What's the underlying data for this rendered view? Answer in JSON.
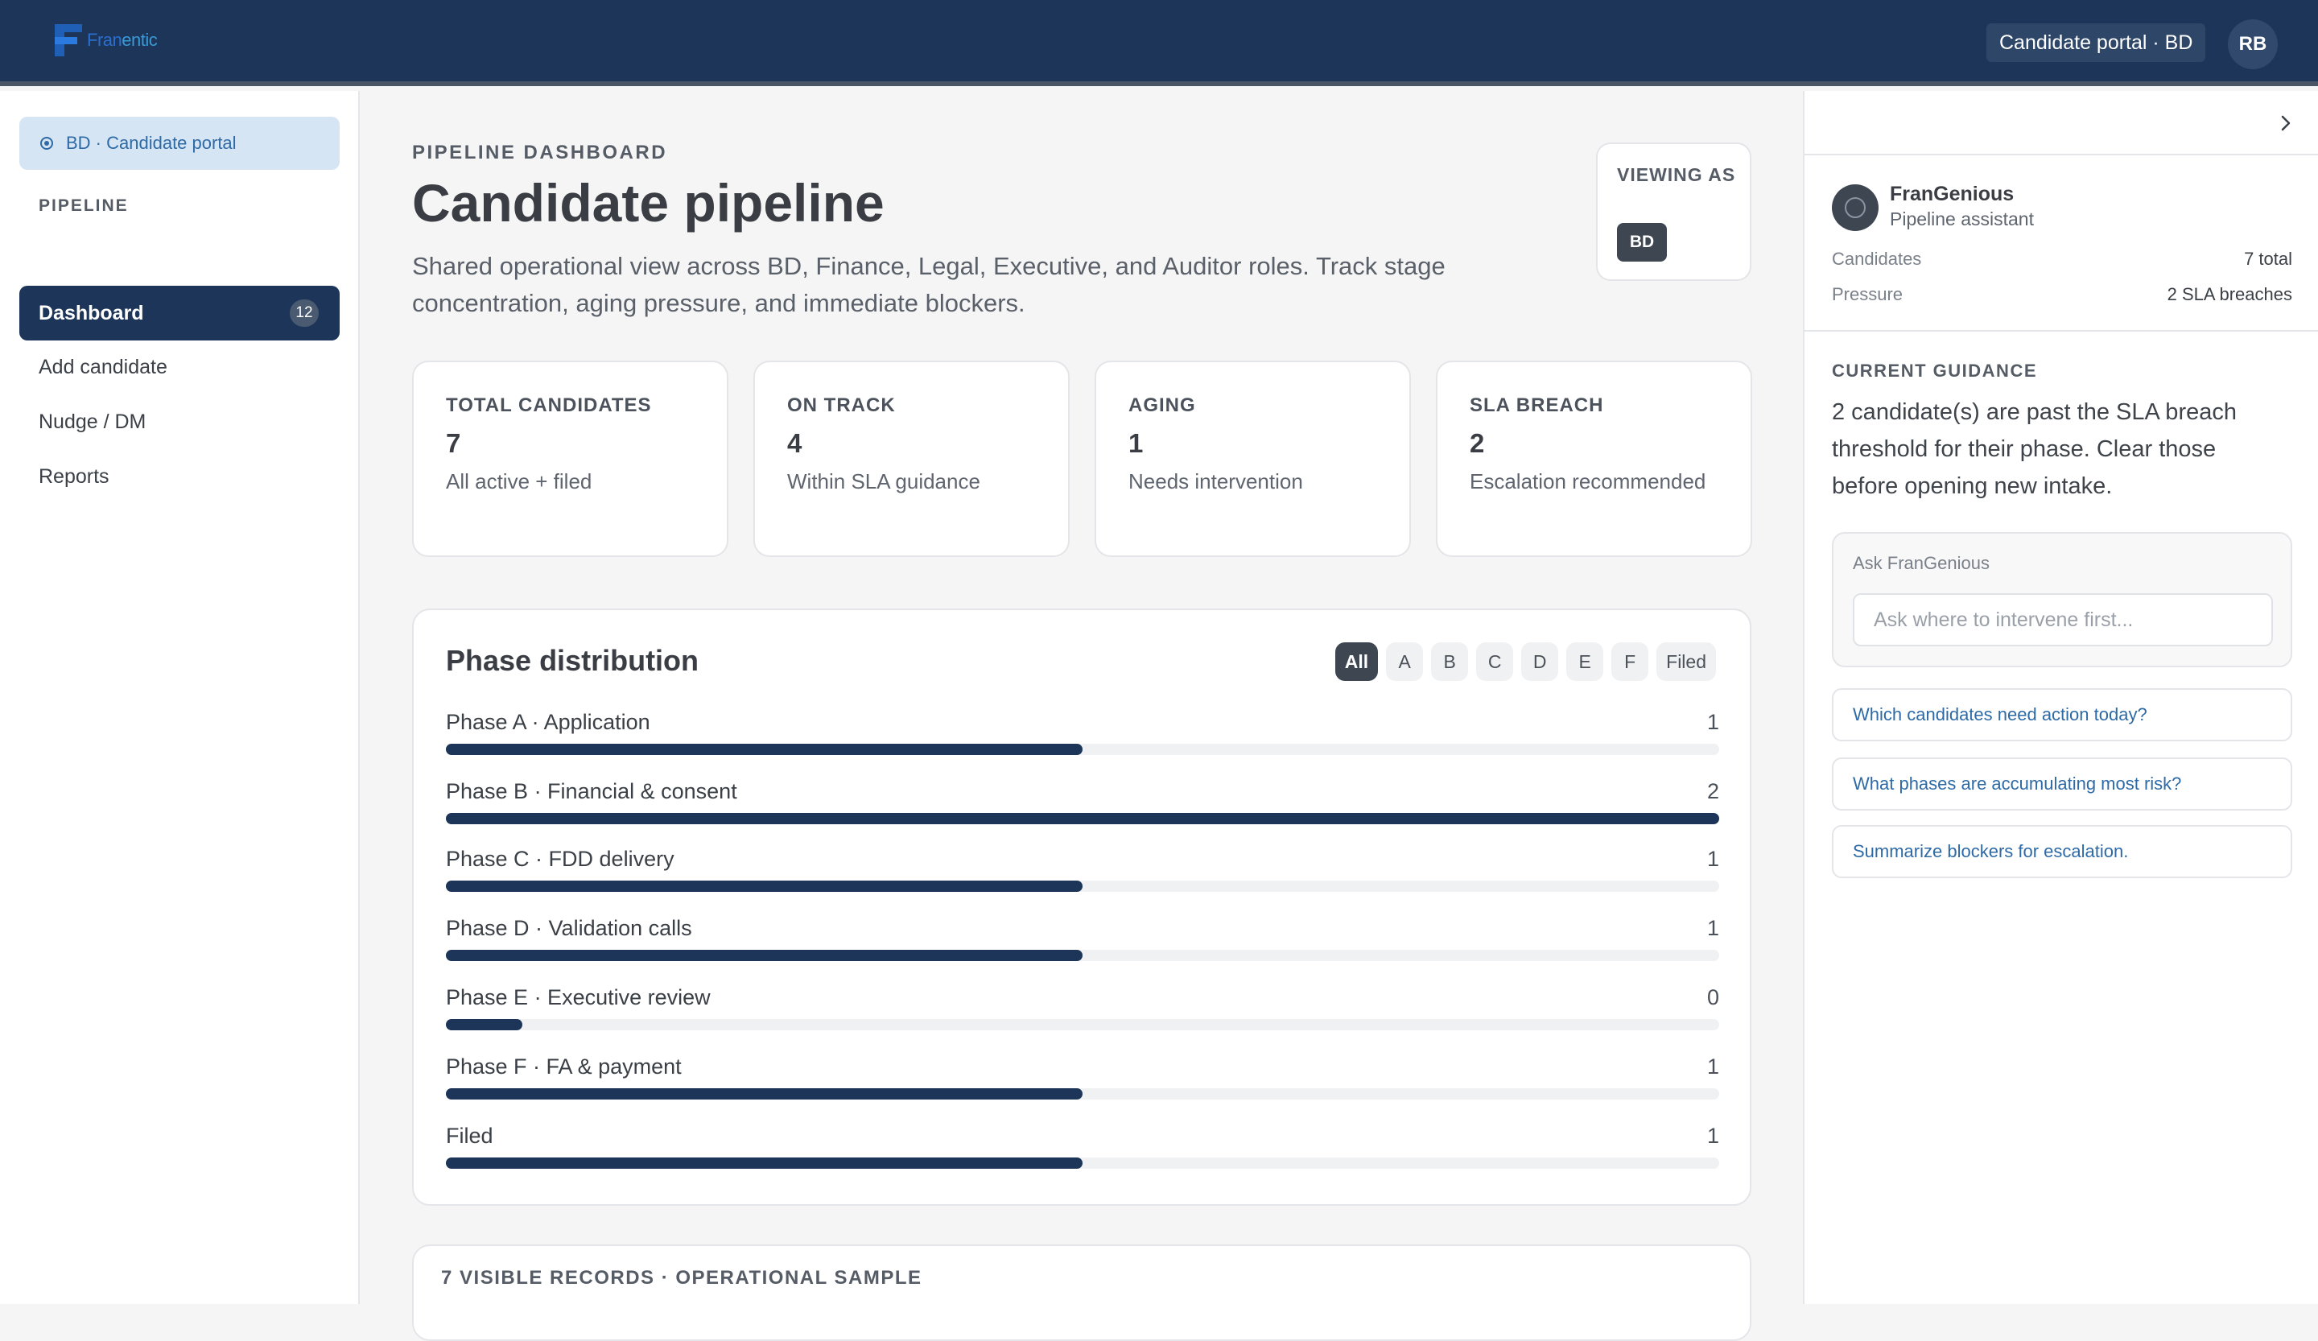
{
  "brand": {
    "name_part1": "Fran",
    "name_part2": "entic"
  },
  "header": {
    "portal_chip": "Candidate portal · BD",
    "avatar_initials": "RB"
  },
  "sidebar": {
    "portal_pill": "BD · Candidate portal",
    "section_label": "PIPELINE",
    "items": [
      {
        "label": "Dashboard",
        "badge": "12",
        "active": true
      },
      {
        "label": "Add candidate"
      },
      {
        "label": "Nudge / DM"
      },
      {
        "label": "Reports"
      }
    ]
  },
  "main": {
    "eyebrow": "PIPELINE DASHBOARD",
    "title": "Candidate pipeline",
    "description": "Shared operational view across BD, Finance, Legal, Executive, and Auditor roles. Track stage concentration, aging pressure, and immediate blockers.",
    "viewing": {
      "label": "VIEWING AS",
      "role": "BD"
    },
    "stats": [
      {
        "label": "TOTAL CANDIDATES",
        "value": "7",
        "sub": "All active + filed"
      },
      {
        "label": "ON TRACK",
        "value": "4",
        "sub": "Within SLA guidance"
      },
      {
        "label": "AGING",
        "value": "1",
        "sub": "Needs intervention"
      },
      {
        "label": "SLA BREACH",
        "value": "2",
        "sub": "Escalation recommended"
      }
    ],
    "phase_distribution": {
      "title": "Phase distribution",
      "filters": [
        "All",
        "A",
        "B",
        "C",
        "D",
        "E",
        "F",
        "Filed"
      ],
      "active_filter": "All",
      "phases": [
        {
          "name": "Phase A · Application",
          "count": 1,
          "fill": 0.5
        },
        {
          "name": "Phase B · Financial & consent",
          "count": 2,
          "fill": 1.0
        },
        {
          "name": "Phase C · FDD delivery",
          "count": 1,
          "fill": 0.5
        },
        {
          "name": "Phase D · Validation calls",
          "count": 1,
          "fill": 0.5
        },
        {
          "name": "Phase E · Executive review",
          "count": 0,
          "fill": 0.06
        },
        {
          "name": "Phase F · FA & payment",
          "count": 1,
          "fill": 0.5
        },
        {
          "name": "Filed",
          "count": 1,
          "fill": 0.5
        }
      ]
    },
    "records_label": "7 VISIBLE RECORDS · OPERATIONAL SAMPLE"
  },
  "assistant": {
    "name": "FranGenious",
    "role": "Pipeline assistant",
    "candidates_label": "Candidates",
    "candidates_value": "7 total",
    "pressure_label": "Pressure",
    "pressure_value": "2 SLA breaches",
    "guidance_label": "CURRENT GUIDANCE",
    "guidance_text": "2 candidate(s) are past the SLA breach threshold for their phase. Clear those before opening new intake.",
    "ask_label": "Ask FranGenious",
    "ask_placeholder": "Ask where to intervene first...",
    "suggestions": [
      "Which candidates need action today?",
      "What phases are accumulating most risk?",
      "Summarize blockers for escalation."
    ]
  },
  "colors": {
    "navy": "#1c3558",
    "link": "#2e6aa6",
    "accent_pill": "#d5e5f3"
  }
}
